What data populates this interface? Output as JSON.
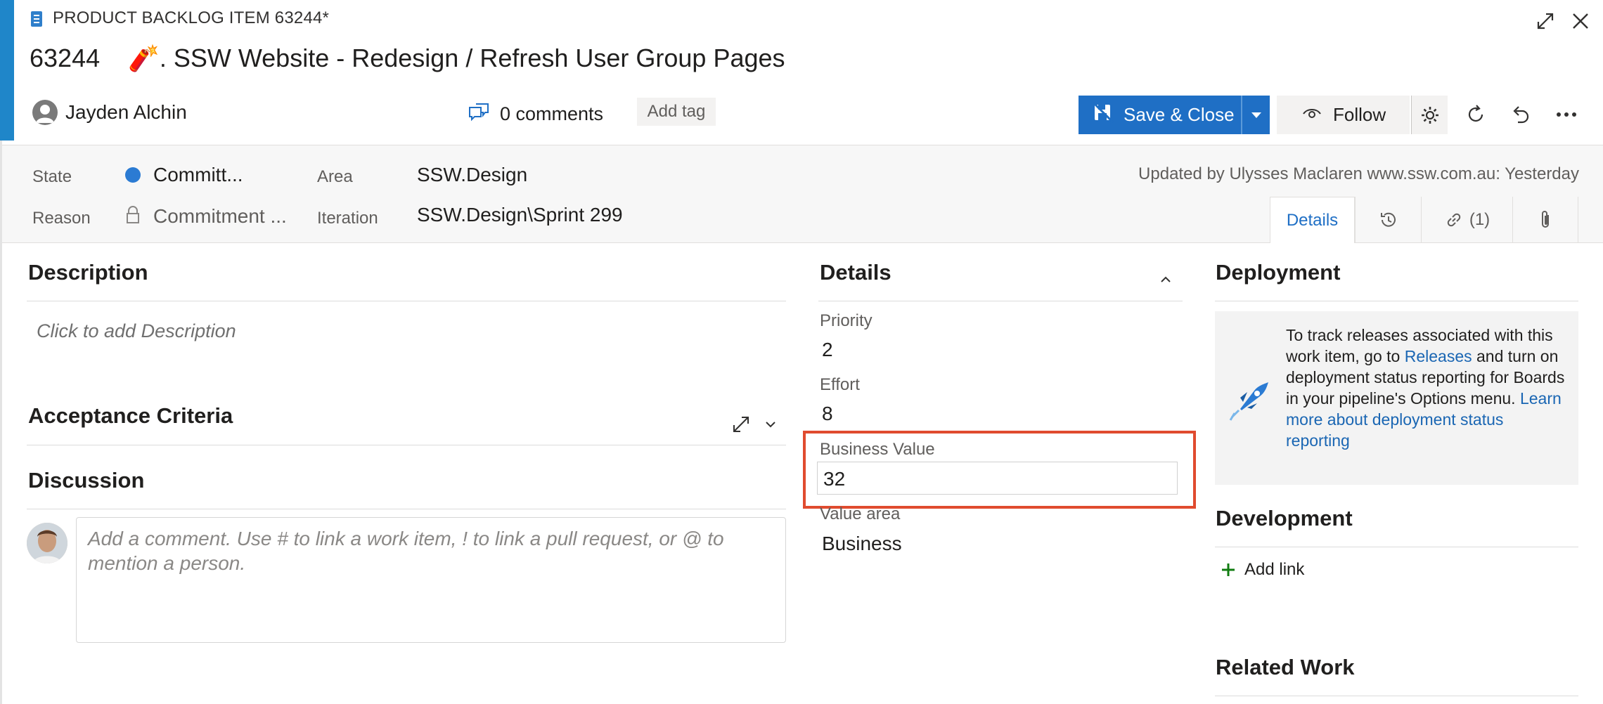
{
  "header": {
    "type_label": "PRODUCT BACKLOG ITEM 63244*",
    "id": "63244",
    "title": "🧨. SSW Website - Redesign / Refresh User Group Pages",
    "assignee": "Jayden Alchin",
    "comments": "0 comments",
    "add_tag": "Add tag"
  },
  "toolbar": {
    "save_label": "Save & Close",
    "follow_label": "Follow"
  },
  "fields": {
    "state_label": "State",
    "state_value": "Committ...",
    "reason_label": "Reason",
    "reason_value": "Commitment ...",
    "area_label": "Area",
    "area_value": "SSW.Design",
    "iteration_label": "Iteration",
    "iteration_value": "SSW.Design\\Sprint 299",
    "updated": "Updated by Ulysses Maclaren www.ssw.com.au: Yesterday"
  },
  "tabs": {
    "details": "Details",
    "links": "(1)"
  },
  "left": {
    "description_title": "Description",
    "description_placeholder": "Click to add Description",
    "acceptance_title": "Acceptance Criteria",
    "discussion_title": "Discussion",
    "comment_placeholder": "Add a comment. Use # to link a work item, ! to link a pull request, or @ to mention a person."
  },
  "details": {
    "title": "Details",
    "priority_label": "Priority",
    "priority_value": "2",
    "effort_label": "Effort",
    "effort_value": "8",
    "business_value_label": "Business Value",
    "business_value": "32",
    "value_area_label": "Value area",
    "value_area_value": "Business"
  },
  "right": {
    "deployment_title": "Deployment",
    "deploy_text_1": "To track releases associated with this work item, go to ",
    "deploy_link_releases": "Releases",
    "deploy_text_2": " and turn on deployment status reporting for Boards in your pipeline's Options menu. ",
    "deploy_link_learn": "Learn more about deployment status reporting",
    "development_title": "Development",
    "add_link": "Add link",
    "related_title": "Related Work"
  },
  "colors": {
    "accent": "#1f6fc5",
    "highlight": "#e04b2f",
    "state_dot": "#2b7bd3"
  }
}
